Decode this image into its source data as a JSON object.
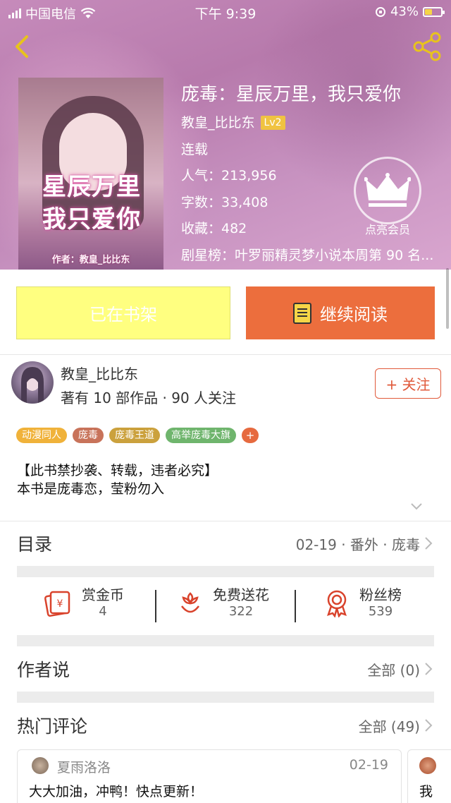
{
  "status_bar": {
    "carrier": "中国电信",
    "time": "下午 9:39",
    "battery": "43%"
  },
  "book": {
    "title": "庞毒：星辰万里，我只爱你",
    "author": "教皇_比比东",
    "level": "Lv2",
    "status": "连载",
    "popularity": "人气：213,956",
    "word_count": "字数：33,408",
    "favorites": "收藏：482",
    "ranking": "剧星榜：叶罗丽精灵梦小说本周第 90 名...",
    "cover_title_line1": "星辰万里",
    "cover_title_line2": "我只爱你",
    "cover_author": "作者：教皇_比比东"
  },
  "vip": {
    "label": "点亮会员"
  },
  "actions": {
    "shelf_label": "已在书架",
    "read_label": "继续阅读"
  },
  "author_card": {
    "name": "教皇_比比东",
    "stats": "著有 10 部作品 · 90 人关注",
    "follow_label": "+ 关注"
  },
  "tags": [
    {
      "label": "动漫同人",
      "color": "#f0b23a"
    },
    {
      "label": "庞毒",
      "color": "#c8735a"
    },
    {
      "label": "庞毒王道",
      "color": "#cba13d"
    },
    {
      "label": "高举庞毒大旗",
      "color": "#6fb56d"
    }
  ],
  "tag_more": "+",
  "description": {
    "line1": "【此书禁抄袭、转载，违者必究】",
    "line2": "本书是庞毒恋，莹粉勿入"
  },
  "catalog": {
    "title": "目录",
    "latest": "02-19 · 番外 · 庞毒"
  },
  "rewards": {
    "coins_label": "赏金币",
    "coins_value": "4",
    "flowers_label": "免费送花",
    "flowers_value": "322",
    "fans_label": "粉丝榜",
    "fans_value": "539"
  },
  "author_says": {
    "title": "作者说",
    "all": "全部 (0)"
  },
  "hot_comments": {
    "title": "热门评论",
    "all": "全部 (49)",
    "items": [
      {
        "user": "夏雨洛洛",
        "date": "02-19",
        "text": "大大加油，冲鸭！快点更新！"
      },
      {
        "text": "我"
      }
    ]
  },
  "colors": {
    "accent": "#ec6e3d",
    "shelf_button": "#ffff80",
    "level_badge": "#f0c341"
  }
}
